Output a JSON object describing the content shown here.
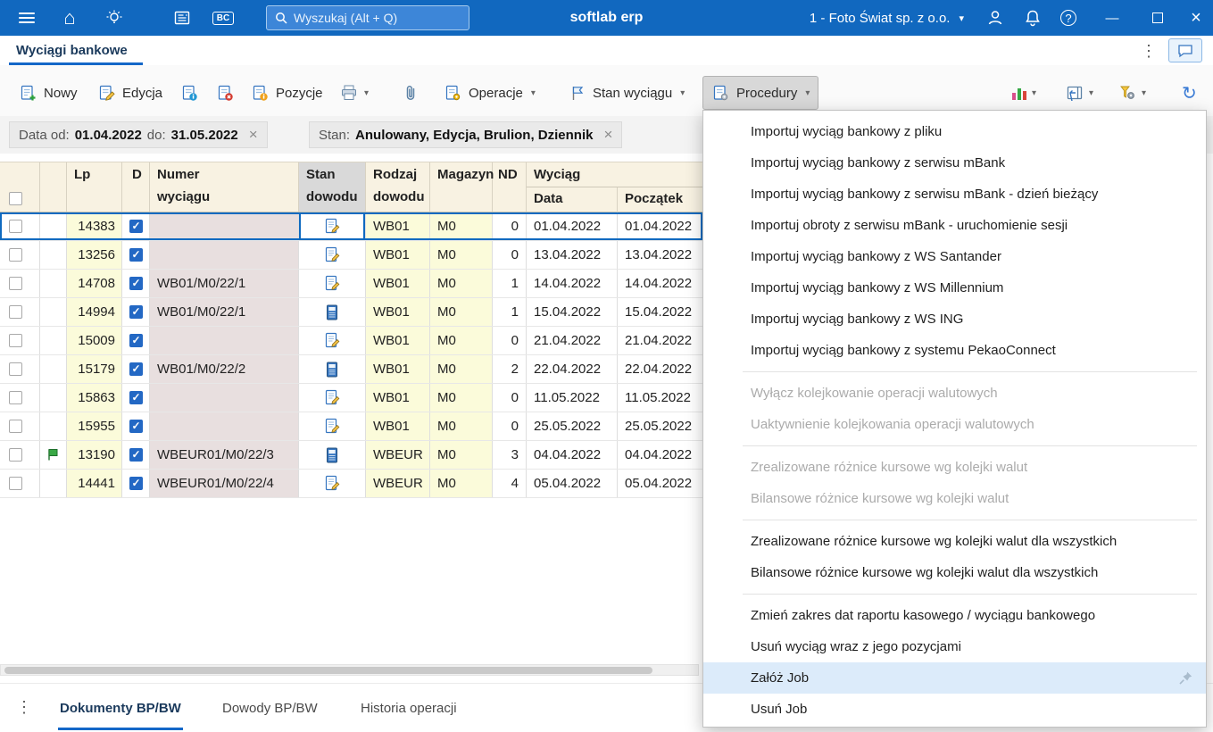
{
  "colors": {
    "topbar_blue": "#1168bf",
    "accent_blue": "#1467c8",
    "selection_blue": "#0f6ac0",
    "header_cream": "#f8f2e2",
    "cell_yellow": "#fbfbda",
    "cell_rose": "#e8dfdf",
    "menu_highlight": "#dcebfa",
    "pressed_gray": "#d8d8d8"
  },
  "topbar": {
    "search_placeholder": "Wyszukaj (Alt + Q)",
    "app_name": "softlab erp",
    "company": "1 - Foto Świat sp. z o.o.",
    "bc_label": "BC"
  },
  "page_tab": {
    "title": "Wyciągi bankowe"
  },
  "toolbar": {
    "nowy": "Nowy",
    "edycja": "Edycja",
    "pozycje": "Pozycje",
    "operacje": "Operacje",
    "stan_wyciagu": "Stan wyciągu",
    "procedury": "Procedury"
  },
  "filters": {
    "date": {
      "label": "Data  od:",
      "from": "01.04.2022",
      "to_label": "do:",
      "to": "31.05.2022"
    },
    "stan": {
      "label": "Stan:",
      "value": "Anulowany, Edycja, Brulion, Dziennik"
    }
  },
  "table": {
    "header": {
      "lp": "Lp",
      "d": "D",
      "numer_l1": "Numer",
      "numer_l2": "wyciągu",
      "stan_l1": "Stan",
      "stan_l2": "dowodu",
      "rodzaj_l1": "Rodzaj",
      "rodzaj_l2": "dowodu",
      "magazyn": "Magazyn",
      "nd": "ND",
      "wyciag": "Wyciąg",
      "data": "Data",
      "poczatek": "Początek"
    },
    "rows": [
      {
        "lp": "14383",
        "numer": "",
        "stan": "draft",
        "rodzaj": "WB01",
        "magazyn": "M0",
        "nd": "0",
        "data": "01.04.2022",
        "poczatek": "01.04.2022",
        "selected": true
      },
      {
        "lp": "13256",
        "numer": "",
        "stan": "draft",
        "rodzaj": "WB01",
        "magazyn": "M0",
        "nd": "0",
        "data": "13.04.2022",
        "poczatek": "13.04.2022"
      },
      {
        "lp": "14708",
        "numer": "WB01/M0/22/1",
        "stan": "draft",
        "rodzaj": "WB01",
        "magazyn": "M0",
        "nd": "1",
        "data": "14.04.2022",
        "poczatek": "14.04.2022"
      },
      {
        "lp": "14994",
        "numer": "WB01/M0/22/1",
        "stan": "book",
        "rodzaj": "WB01",
        "magazyn": "M0",
        "nd": "1",
        "data": "15.04.2022",
        "poczatek": "15.04.2022"
      },
      {
        "lp": "15009",
        "numer": "",
        "stan": "draft",
        "rodzaj": "WB01",
        "magazyn": "M0",
        "nd": "0",
        "data": "21.04.2022",
        "poczatek": "21.04.2022"
      },
      {
        "lp": "15179",
        "numer": "WB01/M0/22/2",
        "stan": "book",
        "rodzaj": "WB01",
        "magazyn": "M0",
        "nd": "2",
        "data": "22.04.2022",
        "poczatek": "22.04.2022"
      },
      {
        "lp": "15863",
        "numer": "",
        "stan": "draft",
        "rodzaj": "WB01",
        "magazyn": "M0",
        "nd": "0",
        "data": "11.05.2022",
        "poczatek": "11.05.2022"
      },
      {
        "lp": "15955",
        "numer": "",
        "stan": "draft",
        "rodzaj": "WB01",
        "magazyn": "M0",
        "nd": "0",
        "data": "25.05.2022",
        "poczatek": "25.05.2022"
      },
      {
        "lp": "13190",
        "numer": "WBEUR01/M0/22/3",
        "stan": "book",
        "rodzaj": "WBEUR",
        "magazyn": "M0",
        "nd": "3",
        "data": "04.04.2022",
        "poczatek": "04.04.2022",
        "flag": true
      },
      {
        "lp": "14441",
        "numer": "WBEUR01/M0/22/4",
        "stan": "draft",
        "rodzaj": "WBEUR",
        "magazyn": "M0",
        "nd": "4",
        "data": "05.04.2022",
        "poczatek": "05.04.2022"
      }
    ]
  },
  "menu": {
    "items": [
      {
        "type": "item",
        "label": "Importuj wyciąg bankowy z pliku"
      },
      {
        "type": "item",
        "label": "Importuj wyciąg bankowy z serwisu mBank"
      },
      {
        "type": "item",
        "label": "Importuj wyciąg bankowy z serwisu mBank - dzień bieżący"
      },
      {
        "type": "item",
        "label": "Importuj obroty z serwisu mBank - uruchomienie sesji"
      },
      {
        "type": "item",
        "label": "Importuj wyciąg bankowy z WS Santander"
      },
      {
        "type": "item",
        "label": "Importuj wyciąg bankowy z WS Millennium"
      },
      {
        "type": "item",
        "label": "Importuj wyciąg bankowy z WS ING"
      },
      {
        "type": "item",
        "label": "Importuj wyciąg bankowy z systemu PekaoConnect"
      },
      {
        "type": "sep"
      },
      {
        "type": "item",
        "label": "Wyłącz kolejkowanie operacji walutowych",
        "disabled": true
      },
      {
        "type": "item",
        "label": "Uaktywnienie kolejkowania operacji walutowych",
        "disabled": true
      },
      {
        "type": "sep"
      },
      {
        "type": "item",
        "label": "Zrealizowane różnice kursowe wg  kolejki walut",
        "disabled": true
      },
      {
        "type": "item",
        "label": "Bilansowe różnice kursowe wg  kolejki walut",
        "disabled": true
      },
      {
        "type": "sep"
      },
      {
        "type": "item",
        "label": "Zrealizowane różnice kursowe wg  kolejki walut dla wszystkich"
      },
      {
        "type": "item",
        "label": "Bilansowe różnice kursowe wg  kolejki walut dla wszystkich"
      },
      {
        "type": "sep"
      },
      {
        "type": "item",
        "label": "Zmień zakres dat raportu kasowego / wyciągu bankowego"
      },
      {
        "type": "item",
        "label": "Usuń wyciąg wraz z jego pozycjami"
      },
      {
        "type": "item",
        "label": "Załóż Job",
        "highlighted": true,
        "pin": true
      },
      {
        "type": "item",
        "label": "Usuń Job"
      }
    ]
  },
  "bottom": {
    "tabs": [
      {
        "label": "Dokumenty BP/BW"
      },
      {
        "label": "Dowody BP/BW"
      },
      {
        "label": "Historia operacji"
      }
    ]
  }
}
